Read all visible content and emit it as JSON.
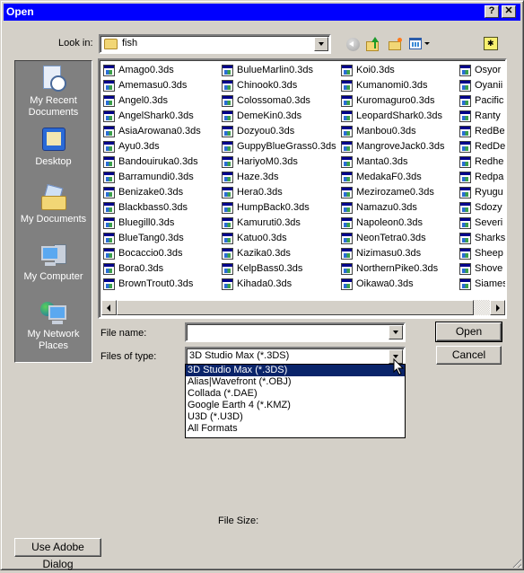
{
  "window": {
    "title": "Open",
    "help_label": "?",
    "close_label": "✕"
  },
  "lookin": {
    "label": "Look in:",
    "value": "fish"
  },
  "toolbar": {
    "icons": [
      "back-icon",
      "up-folder-icon",
      "new-folder-icon",
      "views-menu-icon",
      "special-folder-icon"
    ]
  },
  "places": [
    {
      "label": "My Recent Documents",
      "icon": "recent-documents-icon"
    },
    {
      "label": "Desktop",
      "icon": "desktop-icon"
    },
    {
      "label": "My Documents",
      "icon": "my-documents-icon"
    },
    {
      "label": "My Computer",
      "icon": "my-computer-icon"
    },
    {
      "label": "My Network Places",
      "icon": "network-places-icon"
    }
  ],
  "files": {
    "columns": [
      [
        "Amago0.3ds",
        "Amemasu0.3ds",
        "Angel0.3ds",
        "AngelShark0.3ds",
        "AsiaArowana0.3ds",
        "Ayu0.3ds",
        "Bandouiruka0.3ds",
        "Barramundi0.3ds",
        "Benizake0.3ds",
        "Blackbass0.3ds",
        "Bluegill0.3ds",
        "BlueTang0.3ds",
        "Bocaccio0.3ds",
        "Bora0.3ds",
        "BrownTrout0.3ds"
      ],
      [
        "BulueMarlin0.3ds",
        "Chinook0.3ds",
        "Colossoma0.3ds",
        "DemeKin0.3ds",
        "Dozyou0.3ds",
        "GuppyBlueGrass0.3ds",
        "HariyoM0.3ds",
        "Haze.3ds",
        "Hera0.3ds",
        "HumpBack0.3ds",
        "Kamuruti0.3ds",
        "Katuo0.3ds",
        "Kazika0.3ds",
        "KelpBass0.3ds",
        "Kihada0.3ds"
      ],
      [
        "Koi0.3ds",
        "Kumanomi0.3ds",
        "Kuromaguro0.3ds",
        "LeopardShark0.3ds",
        "Manbou0.3ds",
        "MangroveJack0.3ds",
        "Manta0.3ds",
        "MedakaF0.3ds",
        "Mezirozame0.3ds",
        "Namazu0.3ds",
        "Napoleon0.3ds",
        "NeonTetra0.3ds",
        "Nizimasu0.3ds",
        "NorthernPike0.3ds",
        "Oikawa0.3ds"
      ],
      [
        "Osyor",
        "Oyanii",
        "Pacific",
        "Ranty",
        "RedBe",
        "RedDe",
        "Redhe",
        "Redpa",
        "Ryugu",
        "Sdozy",
        "Severi",
        "Sharks",
        "Sheep",
        "Shove",
        "Siames"
      ]
    ]
  },
  "filename": {
    "label": "File name:",
    "value": ""
  },
  "filetype": {
    "label": "Files of type:",
    "value": "3D Studio Max (*.3DS)",
    "options": [
      "3D Studio Max (*.3DS)",
      "Alias|Wavefront (*.OBJ)",
      "Collada (*.DAE)",
      "Google Earth 4 (*.KMZ)",
      "U3D (*.U3D)",
      "All Formats"
    ],
    "selected_index": 0
  },
  "buttons": {
    "open": "Open",
    "cancel": "Cancel",
    "adobe": "Use Adobe Dialog"
  },
  "filesize": {
    "label": "File Size:"
  }
}
